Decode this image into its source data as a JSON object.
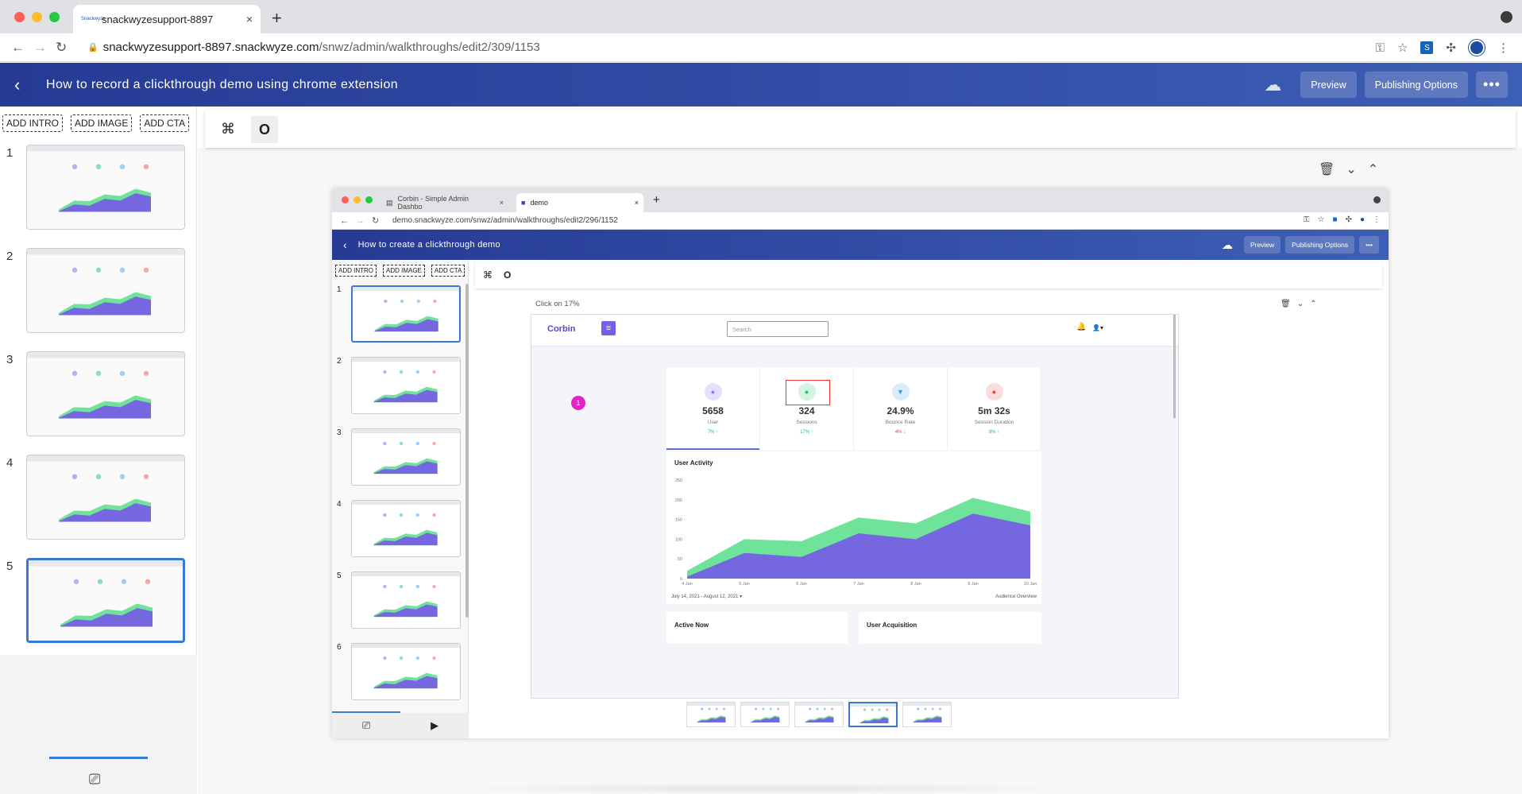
{
  "browser": {
    "tab_title": "snackwyzesupport-8897",
    "tab_favicon_text": "Snackwyze",
    "url_host": "snackwyzesupport-8897.snackwyze.com",
    "url_path": "/snwz/admin/walkthroughs/edit2/309/1153",
    "new_tab": "+",
    "close": "×"
  },
  "header": {
    "back": "‹",
    "title": "How to record a clickthrough demo using chrome extension",
    "preview": "Preview",
    "publishing": "Publishing Options",
    "more": "•••"
  },
  "sidebar": {
    "add_intro": "ADD INTRO",
    "add_image": "ADD IMAGE",
    "add_cta": "ADD CTA",
    "slides": [
      {
        "num": "1"
      },
      {
        "num": "2"
      },
      {
        "num": "3"
      },
      {
        "num": "4"
      },
      {
        "num": "5"
      }
    ]
  },
  "embedded": {
    "tab1": "Corbin - Simple Admin Dashbo",
    "tab2": "demo",
    "url": "demo.snackwyze.com/snwz/admin/walkthroughs/edit2/296/1152",
    "title": "How to create a clickthrough demo",
    "preview": "Preview",
    "publishing": "Publishing Options",
    "more": "•••",
    "add_intro": "ADD INTRO",
    "add_image": "ADD IMAGE",
    "add_cta": "ADD CTA",
    "slides": [
      {
        "num": "1"
      },
      {
        "num": "2"
      },
      {
        "num": "3"
      },
      {
        "num": "4"
      },
      {
        "num": "5"
      },
      {
        "num": "6"
      }
    ],
    "caption": "Click on 17%"
  },
  "dashboard": {
    "logo": "Corbin",
    "search_placeholder": "Search",
    "hotspot": "1",
    "stats": [
      {
        "value": "5658",
        "label": "User",
        "change": "7% ↑",
        "color": "#8e7cf0",
        "bg": "#e5e0fb",
        "chg_color": "#2bb673"
      },
      {
        "value": "324",
        "label": "Sessions",
        "change": "17% ↑",
        "color": "#2bb673",
        "bg": "#d4f3e3",
        "chg_color": "#2bb673"
      },
      {
        "value": "24.9%",
        "label": "Bounce Rate",
        "change": "4% ↓",
        "color": "#2a9df4",
        "bg": "#d8ecfb",
        "chg_color": "#e8413d"
      },
      {
        "value": "5m 32s",
        "label": "Session Duration",
        "change": "8% ↑",
        "color": "#e8413d",
        "bg": "#fbdddd",
        "chg_color": "#2bb673"
      }
    ],
    "activity_title": "User Activity",
    "date_range": "July 14, 2021 - August 12, 2021 ▾",
    "audience": "Audience Overview",
    "active_now": "Active Now",
    "user_acq": "User Acquisition"
  },
  "chart_data": {
    "type": "area",
    "title": "User Activity",
    "categories": [
      "4 Jan",
      "5 Jan",
      "6 Jan",
      "7 Jan",
      "8 Jan",
      "9 Jan",
      "10 Jan"
    ],
    "ylim": [
      0,
      250
    ],
    "yticks": [
      0,
      50,
      100,
      150,
      200,
      250
    ],
    "series": [
      {
        "color": "#6fe39a",
        "values": [
          20,
          100,
          95,
          155,
          140,
          205,
          170
        ]
      },
      {
        "color": "#7467e0",
        "values": [
          5,
          65,
          55,
          115,
          100,
          165,
          135
        ]
      }
    ]
  }
}
